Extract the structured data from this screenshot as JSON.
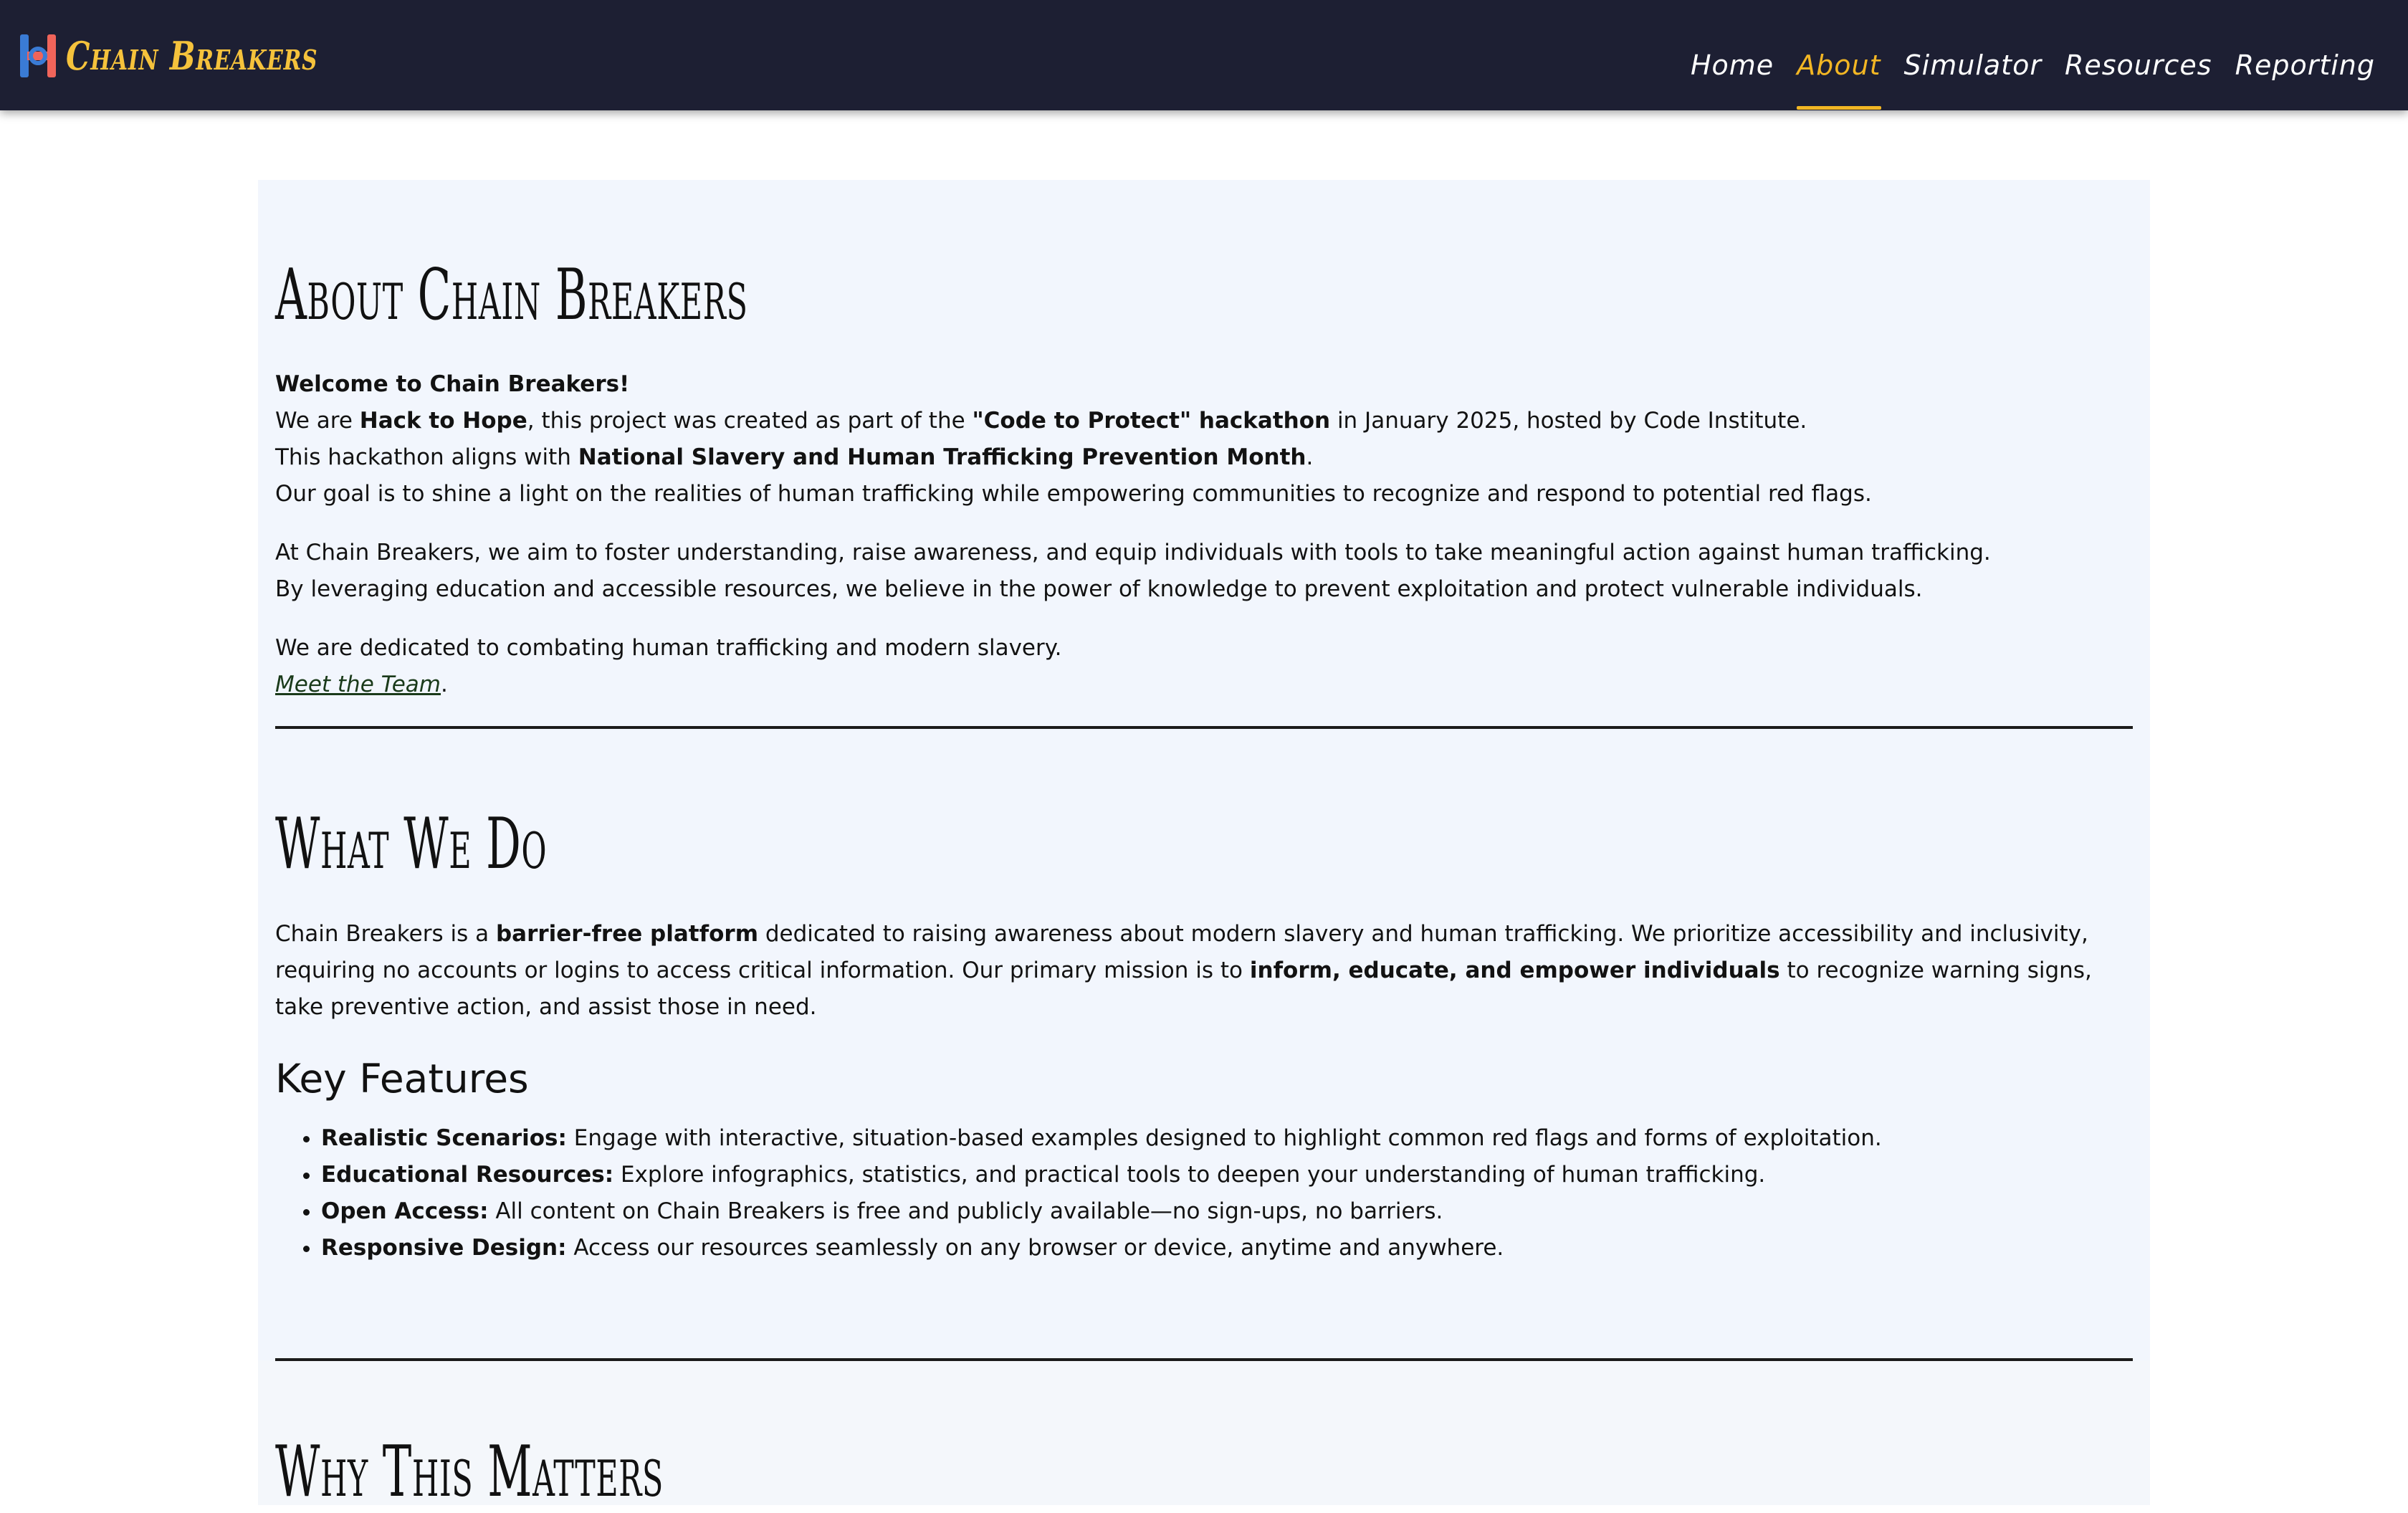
{
  "navbar": {
    "brand": "Chain Breakers",
    "links": [
      {
        "label": "Home",
        "active": false
      },
      {
        "label": "About",
        "active": true
      },
      {
        "label": "Simulator",
        "active": false
      },
      {
        "label": "Resources",
        "active": false
      },
      {
        "label": "Reporting",
        "active": false
      }
    ]
  },
  "about": {
    "title": "About Chain Breakers",
    "welcome": "Welcome to Chain Breakers!",
    "p1": {
      "l1_a": "We are ",
      "l1_b": "Hack to Hope",
      "l1_c": ", this project was created as part of the ",
      "l1_d": "\"Code to Protect\" hackathon",
      "l1_e": " in January 2025, hosted by Code Institute.",
      "l2_a": "This hackathon aligns with ",
      "l2_b": "National Slavery and Human Trafficking Prevention Month",
      "l2_c": ".",
      "l3": "Our goal is to shine a light on the realities of human trafficking while empowering communities to recognize and respond to potential red flags."
    },
    "p2": {
      "l1": "At Chain Breakers, we aim to foster understanding, raise awareness, and equip individuals with tools to take meaningful action against human trafficking.",
      "l2": "By leveraging education and accessible resources, we believe in the power of knowledge to prevent exploitation and protect vulnerable individuals."
    },
    "p3": {
      "l1": "We are dedicated to combating human trafficking and modern slavery.",
      "link": "Meet the Team",
      "after_link": "."
    }
  },
  "what_we_do": {
    "title": "What We Do",
    "p_a": "Chain Breakers is a ",
    "p_b": "barrier-free platform",
    "p_c": " dedicated to raising awareness about modern slavery and human trafficking. We prioritize accessibility and inclusivity, requiring no accounts or logins to access critical information. Our primary mission is to ",
    "p_d": "inform, educate, and empower individuals",
    "p_e": " to recognize warning signs, take preventive action, and assist those in need.",
    "features_heading": "Key Features",
    "features": [
      {
        "name": "Realistic Scenarios:",
        "text": " Engage with interactive, situation-based examples designed to highlight common red flags and forms of exploitation."
      },
      {
        "name": "Educational Resources:",
        "text": " Explore infographics, statistics, and practical tools to deepen your understanding of human trafficking."
      },
      {
        "name": "Open Access:",
        "text": " All content on Chain Breakers is free and publicly available—no sign-ups, no barriers."
      },
      {
        "name": "Responsive Design:",
        "text": " Access our resources seamlessly on any browser or device, anytime and anywhere."
      }
    ]
  },
  "why": {
    "title": "Why This Matters"
  },
  "colors": {
    "navbar_bg": "#1d1f33",
    "brand_accent": "#f5c23c",
    "active_link": "#f2b624",
    "panel_bg": "#f2f6fd",
    "logo_blue": "#3a7bd5",
    "logo_red": "#f0645a"
  }
}
